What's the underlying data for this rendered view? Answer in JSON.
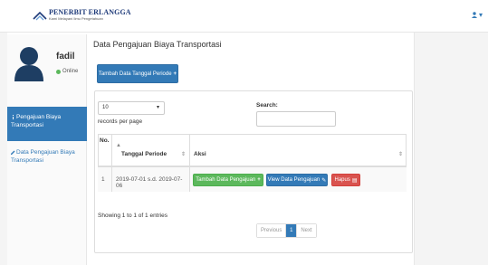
{
  "header": {
    "logo_title": "PENERBIT ERLANGGA",
    "logo_subtitle": "Kami Melayani Ilmu Pengetahuan",
    "user_caret": "▾"
  },
  "sidebar": {
    "user_name": "fadil",
    "status": "Online",
    "items": [
      {
        "label": "Pengajuan Biaya Transportasi",
        "active": true
      },
      {
        "label": "Data Pengajuan Biaya Transportasi",
        "active": false
      }
    ]
  },
  "main": {
    "title": "Data Pengajuan Biaya Transportasi",
    "add_period_button": "Tambah Data Tanggal Periode",
    "records_select_value": "10",
    "records_label": "records per page",
    "search_label": "Search:",
    "search_value": "",
    "table": {
      "headers": {
        "no": "No.",
        "date": "Tanggal Periode",
        "action": "Aksi"
      },
      "rows": [
        {
          "no": "1",
          "date": "2019-07-01 s.d. 2019-07-06",
          "actions": {
            "add": "Tambah Data Pengajuan",
            "view": "View Data Pengajuan",
            "delete": "Hapus"
          }
        }
      ]
    },
    "showing": "Showing 1 to 1 of 1 entries",
    "pagination": {
      "previous": "Previous",
      "current": "1",
      "next": "Next"
    }
  },
  "colors": {
    "primary": "#337ab7",
    "success": "#5cb85c",
    "danger": "#d9534f",
    "online": "#5cb85c"
  }
}
